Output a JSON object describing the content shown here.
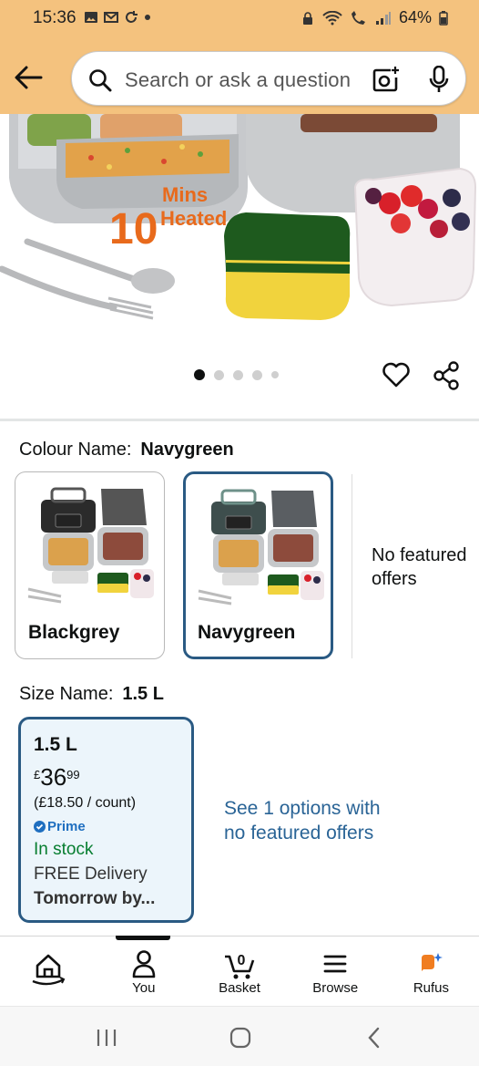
{
  "status_bar": {
    "time": "15:36",
    "battery": "64%"
  },
  "header": {
    "search_placeholder": "Search or ask a question",
    "background": "#f4c27e"
  },
  "hero": {
    "badge_number": "10",
    "badge_text_top": "Mins",
    "badge_text_bottom": "Heated",
    "image_count": 5,
    "active_image": 1
  },
  "colour": {
    "label": "Colour Name:",
    "selected": "Navygreen",
    "options": [
      {
        "name": "Blackgrey",
        "selected": false
      },
      {
        "name": "Navygreen",
        "selected": true
      }
    ],
    "no_featured": "No featured offers"
  },
  "size": {
    "label": "Size Name:",
    "selected": "1.5 L",
    "card": {
      "title": "1.5 L",
      "currency": "£",
      "price_whole": "36",
      "price_fraction": "99",
      "unit_price": "(£18.50 / count)",
      "prime": "Prime",
      "stock": "In stock",
      "delivery": "FREE Delivery",
      "delivery_date": "Tomorrow by..."
    },
    "see_options": "See 1 options with no featured offers"
  },
  "bottom_nav": {
    "items": [
      {
        "label": ""
      },
      {
        "label": "You"
      },
      {
        "label": "Basket",
        "count": "0"
      },
      {
        "label": "Browse"
      },
      {
        "label": "Rufus"
      }
    ]
  },
  "colors": {
    "accent_blue": "#2a5a83",
    "link_blue": "#2a6496",
    "stock_green": "#067d2f",
    "prime_blue": "#1f6fc0"
  }
}
